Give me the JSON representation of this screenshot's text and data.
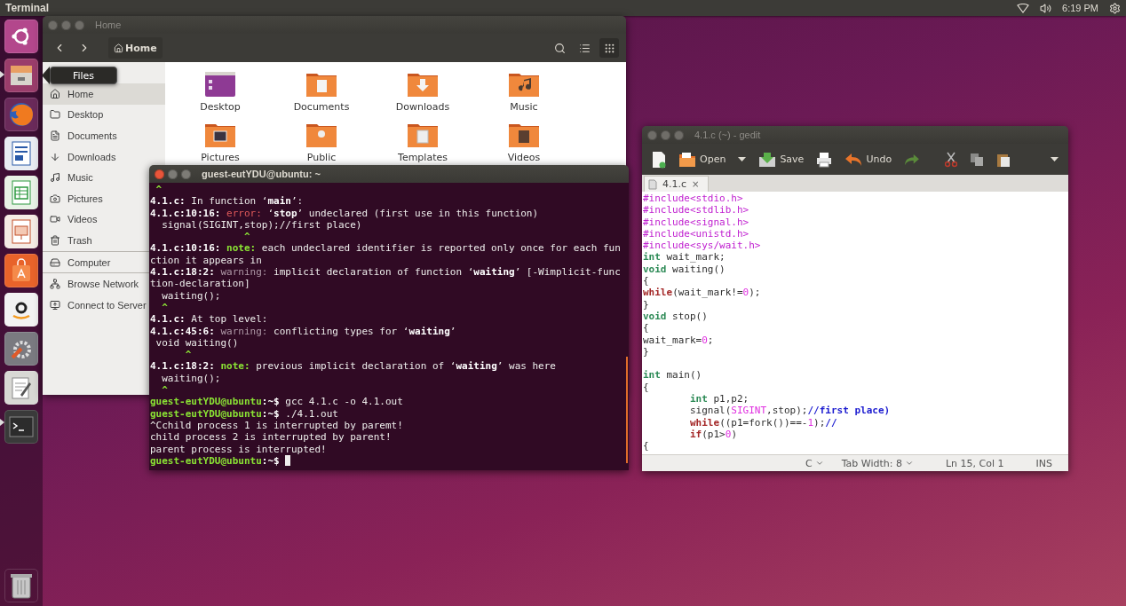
{
  "top_bar": {
    "app_title": "Terminal",
    "clock": "6:19 PM"
  },
  "launcher": {
    "tooltip": "Files"
  },
  "files_window": {
    "title": "Home",
    "path_button": "Home",
    "sidebar": [
      {
        "items": [
          {
            "label": "Home",
            "selected": true
          },
          {
            "label": "Desktop",
            "selected": false
          },
          {
            "label": "Documents",
            "selected": false
          },
          {
            "label": "Downloads",
            "selected": false
          },
          {
            "label": "Music",
            "selected": false
          },
          {
            "label": "Pictures",
            "selected": false
          },
          {
            "label": "Videos",
            "selected": false
          },
          {
            "label": "Trash",
            "selected": false
          }
        ]
      },
      {
        "items": [
          {
            "label": "Computer",
            "selected": false
          }
        ]
      },
      {
        "items": [
          {
            "label": "Browse Network",
            "selected": false
          },
          {
            "label": "Connect to Server",
            "selected": false
          }
        ]
      }
    ],
    "items": [
      {
        "label": "Desktop"
      },
      {
        "label": "Documents"
      },
      {
        "label": "Downloads"
      },
      {
        "label": "Music"
      },
      {
        "label": "Pictures"
      },
      {
        "label": "Public"
      },
      {
        "label": "Templates"
      },
      {
        "label": "Videos"
      }
    ]
  },
  "terminal_window": {
    "title": "guest-eutYDU@ubuntu: ~",
    "cursor": true,
    "lines": [
      [
        {
          "kind": "caret",
          "text": " ^"
        }
      ],
      [
        {
          "kind": "bold",
          "text": "4.1.c:"
        },
        {
          "kind": "plain",
          "text": " In function ‘"
        },
        {
          "kind": "bold",
          "text": "main"
        },
        {
          "kind": "plain",
          "text": "’:"
        }
      ],
      [
        {
          "kind": "bold",
          "text": "4.1.c:10:16: "
        },
        {
          "kind": "error",
          "text": "error:"
        },
        {
          "kind": "plain",
          "text": " ‘"
        },
        {
          "kind": "bold",
          "text": "stop"
        },
        {
          "kind": "plain",
          "text": "’ undeclared (first use in this function)"
        }
      ],
      [
        {
          "kind": "plain",
          "text": "  signal(SIGINT,stop);//first place)"
        }
      ],
      [
        {
          "kind": "caret",
          "text": "                ^"
        }
      ],
      [
        {
          "kind": "bold",
          "text": "4.1.c:10:16: "
        },
        {
          "kind": "note",
          "text": "note:"
        },
        {
          "kind": "plain",
          "text": " each undeclared identifier is reported only once for each fun"
        }
      ],
      [
        {
          "kind": "plain",
          "text": "ction it appears in"
        }
      ],
      [
        {
          "kind": "bold",
          "text": "4.1.c:18:2: "
        },
        {
          "kind": "warning",
          "text": "warning:"
        },
        {
          "kind": "plain",
          "text": " implicit declaration of function ‘"
        },
        {
          "kind": "bold",
          "text": "waiting"
        },
        {
          "kind": "plain",
          "text": "’ [-Wimplicit-func"
        }
      ],
      [
        {
          "kind": "plain",
          "text": "tion-declaration]"
        }
      ],
      [
        {
          "kind": "plain",
          "text": "  waiting();"
        }
      ],
      [
        {
          "kind": "caret",
          "text": "  ^"
        }
      ],
      [
        {
          "kind": "bold",
          "text": "4.1.c:"
        },
        {
          "kind": "plain",
          "text": " At top level:"
        }
      ],
      [
        {
          "kind": "bold",
          "text": "4.1.c:45:6: "
        },
        {
          "kind": "warning",
          "text": "warning:"
        },
        {
          "kind": "plain",
          "text": " conflicting types for ‘"
        },
        {
          "kind": "bold",
          "text": "waiting"
        },
        {
          "kind": "plain",
          "text": "’"
        }
      ],
      [
        {
          "kind": "plain",
          "text": " void waiting()"
        }
      ],
      [
        {
          "kind": "caret",
          "text": "      ^"
        }
      ],
      [
        {
          "kind": "bold",
          "text": "4.1.c:18:2: "
        },
        {
          "kind": "note",
          "text": "note:"
        },
        {
          "kind": "plain",
          "text": " previous implicit declaration of ‘"
        },
        {
          "kind": "bold",
          "text": "waiting"
        },
        {
          "kind": "plain",
          "text": "’ was here"
        }
      ],
      [
        {
          "kind": "plain",
          "text": "  waiting();"
        }
      ],
      [
        {
          "kind": "caret",
          "text": "  ^"
        }
      ],
      [
        {
          "kind": "prompt",
          "text": "guest-eutYDU@ubuntu"
        },
        {
          "kind": "bold",
          "text": ":~$"
        },
        {
          "kind": "plain",
          "text": " gcc 4.1.c -o 4.1.out"
        }
      ],
      [
        {
          "kind": "prompt",
          "text": "guest-eutYDU@ubuntu"
        },
        {
          "kind": "bold",
          "text": ":~$"
        },
        {
          "kind": "plain",
          "text": " ./4.1.out"
        }
      ],
      [
        {
          "kind": "plain",
          "text": "^Cchild process 1 is interrupted by paremt!"
        }
      ],
      [
        {
          "kind": "plain",
          "text": "child process 2 is interrupted by parent!"
        }
      ],
      [
        {
          "kind": "plain",
          "text": "parent process is interrupted!"
        }
      ],
      [
        {
          "kind": "prompt",
          "text": "guest-eutYDU@ubuntu"
        },
        {
          "kind": "bold",
          "text": ":~$"
        }
      ]
    ]
  },
  "gedit_window": {
    "title": "4.1.c (~) - gedit",
    "toolbar": {
      "open": "Open",
      "save": "Save",
      "undo": "Undo"
    },
    "tab": {
      "label": "4.1.c",
      "close": "×"
    },
    "lines": [
      {
        "kind": "code",
        "indented": false,
        "segments": [
          {
            "kind": "preproc",
            "text": "#include<stdio.h>"
          }
        ]
      },
      {
        "kind": "code",
        "indented": false,
        "segments": [
          {
            "kind": "preproc",
            "text": "#include<stdlib.h>"
          }
        ]
      },
      {
        "kind": "code",
        "indented": false,
        "segments": [
          {
            "kind": "preproc",
            "text": "#include<signal.h>"
          }
        ]
      },
      {
        "kind": "code",
        "indented": false,
        "segments": [
          {
            "kind": "preproc",
            "text": "#include<unistd.h>"
          }
        ]
      },
      {
        "kind": "code",
        "indented": false,
        "segments": [
          {
            "kind": "preproc",
            "text": "#include<sys/wait.h>"
          }
        ]
      },
      {
        "kind": "code",
        "indented": false,
        "segments": [
          {
            "kind": "type",
            "text": "int"
          },
          {
            "kind": "plain",
            "text": " wait_mark;"
          }
        ]
      },
      {
        "kind": "code",
        "indented": false,
        "segments": [
          {
            "kind": "type",
            "text": "void"
          },
          {
            "kind": "plain",
            "text": " waiting()"
          }
        ]
      },
      {
        "kind": "code",
        "indented": false,
        "segments": [
          {
            "kind": "plain",
            "text": "{"
          }
        ]
      },
      {
        "kind": "code",
        "indented": false,
        "segments": [
          {
            "kind": "keyword",
            "text": "while"
          },
          {
            "kind": "plain",
            "text": "(wait_mark!="
          },
          {
            "kind": "number",
            "text": "0"
          },
          {
            "kind": "plain",
            "text": ");"
          }
        ]
      },
      {
        "kind": "code",
        "indented": false,
        "segments": [
          {
            "kind": "plain",
            "text": "}"
          }
        ]
      },
      {
        "kind": "code",
        "indented": false,
        "segments": [
          {
            "kind": "type",
            "text": "void"
          },
          {
            "kind": "plain",
            "text": " stop()"
          }
        ]
      },
      {
        "kind": "code",
        "indented": false,
        "segments": [
          {
            "kind": "plain",
            "text": "{"
          }
        ]
      },
      {
        "kind": "code",
        "indented": false,
        "segments": [
          {
            "kind": "plain",
            "text": "wait_mark="
          },
          {
            "kind": "number",
            "text": "0"
          },
          {
            "kind": "plain",
            "text": ";"
          }
        ]
      },
      {
        "kind": "code",
        "indented": false,
        "segments": [
          {
            "kind": "plain",
            "text": "}"
          }
        ]
      },
      {
        "kind": "blank"
      },
      {
        "kind": "code",
        "indented": false,
        "segments": [
          {
            "kind": "type",
            "text": "int"
          },
          {
            "kind": "plain",
            "text": " main()"
          }
        ]
      },
      {
        "kind": "code",
        "indented": false,
        "segments": [
          {
            "kind": "plain",
            "text": "{"
          }
        ]
      },
      {
        "kind": "code",
        "indented": true,
        "segments": [
          {
            "kind": "type",
            "text": "int"
          },
          {
            "kind": "plain",
            "text": " p1,p2;"
          }
        ]
      },
      {
        "kind": "code",
        "indented": true,
        "segments": [
          {
            "kind": "plain",
            "text": "signal("
          },
          {
            "kind": "number",
            "text": "SIGINT"
          },
          {
            "kind": "plain",
            "text": ",stop);"
          },
          {
            "kind": "comment",
            "text": "//first place)"
          }
        ]
      },
      {
        "kind": "code",
        "indented": true,
        "segments": [
          {
            "kind": "keyword",
            "text": "while"
          },
          {
            "kind": "plain",
            "text": "((p1=fork())==-"
          },
          {
            "kind": "number",
            "text": "1"
          },
          {
            "kind": "plain",
            "text": ");"
          },
          {
            "kind": "comment",
            "text": "//"
          }
        ]
      },
      {
        "kind": "code",
        "indented": true,
        "segments": [
          {
            "kind": "keyword",
            "text": "if"
          },
          {
            "kind": "plain",
            "text": "(p1>"
          },
          {
            "kind": "number",
            "text": "0"
          },
          {
            "kind": "plain",
            "text": ")"
          }
        ]
      },
      {
        "kind": "code",
        "indented": false,
        "segments": [
          {
            "kind": "plain",
            "text": "{"
          }
        ]
      }
    ],
    "status_bar": {
      "language": "C",
      "tab_width": "Tab Width: 8",
      "position": "Ln 15, Col 1",
      "mode": "INS"
    }
  }
}
